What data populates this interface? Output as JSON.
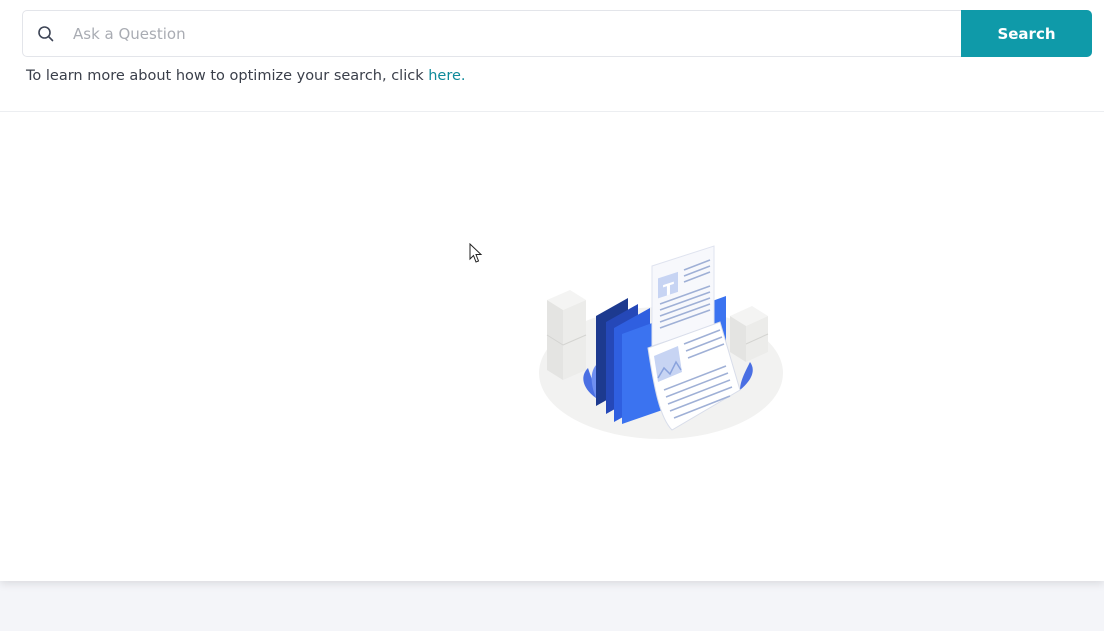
{
  "search": {
    "placeholder": "Ask a Question",
    "value": "",
    "button_label": "Search",
    "search_icon": "search-icon"
  },
  "help": {
    "text": "To learn more about how to optimize your search, click ",
    "link_text": "here."
  },
  "illustration": {
    "icon": "documents-illustration"
  },
  "colors": {
    "accent": "#0f9aa9",
    "link": "#0f8a9a",
    "folder_dark": "#1d3a8f",
    "folder_mid": "#2f5fe0",
    "folder_light": "#3b73f0",
    "page_bg": "#f4f5f9"
  }
}
